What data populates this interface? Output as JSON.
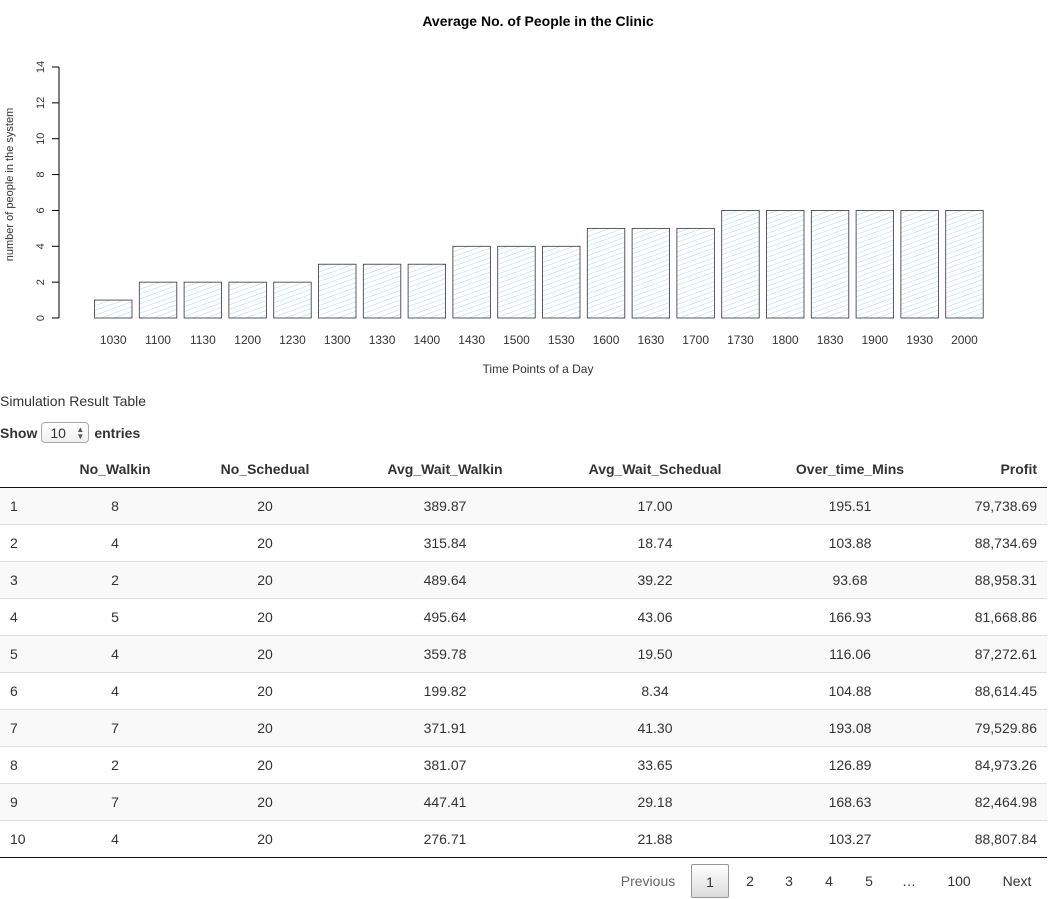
{
  "chart_data": {
    "type": "bar",
    "title": "Average No. of People in the Clinic",
    "xlabel": "Time Points of a Day",
    "ylabel": "number of people in the system",
    "categories": [
      "1030",
      "1100",
      "1130",
      "1200",
      "1230",
      "1300",
      "1330",
      "1400",
      "1430",
      "1500",
      "1530",
      "1600",
      "1630",
      "1700",
      "1730",
      "1800",
      "1830",
      "1900",
      "1930",
      "2000"
    ],
    "values": [
      1,
      2,
      2,
      2,
      2,
      3,
      3,
      3,
      4,
      4,
      4,
      5,
      5,
      5,
      6,
      6,
      6,
      6,
      6,
      6
    ],
    "ylim": [
      0,
      14
    ],
    "yticks": [
      "0",
      "2",
      "4",
      "6",
      "8",
      "10",
      "12",
      "14"
    ],
    "bar_fill": "hatched",
    "hatch_color": "#add8e6",
    "grid": false
  },
  "table_title": "Simulation Result Table",
  "length_menu": {
    "prefix": "Show",
    "value": "10",
    "suffix": "entries"
  },
  "table": {
    "columns": [
      "",
      "No_Walkin",
      "No_Schedual",
      "Avg_Wait_Walkin",
      "Avg_Wait_Schedual",
      "Over_time_Mins",
      "Profit"
    ],
    "rows": [
      [
        "1",
        "8",
        "20",
        "389.87",
        "17.00",
        "195.51",
        "79,738.69"
      ],
      [
        "2",
        "4",
        "20",
        "315.84",
        "18.74",
        "103.88",
        "88,734.69"
      ],
      [
        "3",
        "2",
        "20",
        "489.64",
        "39.22",
        "93.68",
        "88,958.31"
      ],
      [
        "4",
        "5",
        "20",
        "495.64",
        "43.06",
        "166.93",
        "81,668.86"
      ],
      [
        "5",
        "4",
        "20",
        "359.78",
        "19.50",
        "116.06",
        "87,272.61"
      ],
      [
        "6",
        "4",
        "20",
        "199.82",
        "8.34",
        "104.88",
        "88,614.45"
      ],
      [
        "7",
        "7",
        "20",
        "371.91",
        "41.30",
        "193.08",
        "79,529.86"
      ],
      [
        "8",
        "2",
        "20",
        "381.07",
        "33.65",
        "126.89",
        "84,973.26"
      ],
      [
        "9",
        "7",
        "20",
        "447.41",
        "29.18",
        "168.63",
        "82,464.98"
      ],
      [
        "10",
        "4",
        "20",
        "276.71",
        "21.88",
        "103.27",
        "88,807.84"
      ]
    ]
  },
  "pagination": {
    "previous": "Previous",
    "pages": [
      "1",
      "2",
      "3",
      "4",
      "5",
      "…",
      "100"
    ],
    "current": "1",
    "next": "Next"
  }
}
